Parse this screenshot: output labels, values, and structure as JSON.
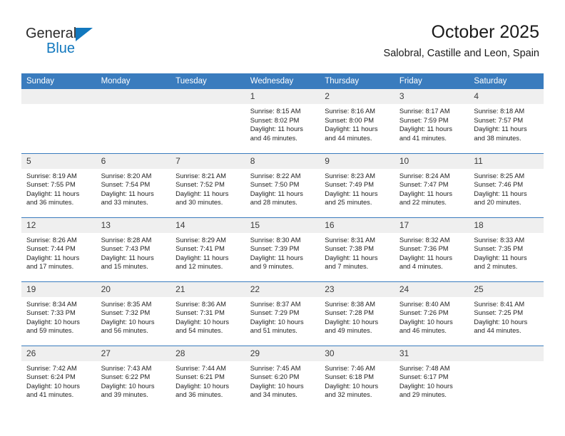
{
  "brand": {
    "name_part1": "General",
    "name_part2": "Blue",
    "triangle_color": "#1278be"
  },
  "header": {
    "title": "October 2025",
    "subtitle": "Salobral, Castille and Leon, Spain"
  },
  "theme": {
    "header_row_bg": "#3a7cbe",
    "header_row_text": "#ffffff",
    "date_band_bg": "#efefef",
    "separator": "#3a7cbe"
  },
  "weekday_headers": [
    "Sunday",
    "Monday",
    "Tuesday",
    "Wednesday",
    "Thursday",
    "Friday",
    "Saturday"
  ],
  "labels": {
    "sunrise_prefix": "Sunrise:",
    "sunset_prefix": "Sunset:",
    "daylight_prefix": "Daylight:"
  },
  "weeks": [
    [
      {
        "day": "",
        "empty": true
      },
      {
        "day": "",
        "empty": true
      },
      {
        "day": "",
        "empty": true
      },
      {
        "day": "1",
        "sunrise": "Sunrise: 8:15 AM",
        "sunset": "Sunset: 8:02 PM",
        "daylight_line1": "Daylight: 11 hours",
        "daylight_line2": "and 46 minutes."
      },
      {
        "day": "2",
        "sunrise": "Sunrise: 8:16 AM",
        "sunset": "Sunset: 8:00 PM",
        "daylight_line1": "Daylight: 11 hours",
        "daylight_line2": "and 44 minutes."
      },
      {
        "day": "3",
        "sunrise": "Sunrise: 8:17 AM",
        "sunset": "Sunset: 7:59 PM",
        "daylight_line1": "Daylight: 11 hours",
        "daylight_line2": "and 41 minutes."
      },
      {
        "day": "4",
        "sunrise": "Sunrise: 8:18 AM",
        "sunset": "Sunset: 7:57 PM",
        "daylight_line1": "Daylight: 11 hours",
        "daylight_line2": "and 38 minutes."
      }
    ],
    [
      {
        "day": "5",
        "sunrise": "Sunrise: 8:19 AM",
        "sunset": "Sunset: 7:55 PM",
        "daylight_line1": "Daylight: 11 hours",
        "daylight_line2": "and 36 minutes."
      },
      {
        "day": "6",
        "sunrise": "Sunrise: 8:20 AM",
        "sunset": "Sunset: 7:54 PM",
        "daylight_line1": "Daylight: 11 hours",
        "daylight_line2": "and 33 minutes."
      },
      {
        "day": "7",
        "sunrise": "Sunrise: 8:21 AM",
        "sunset": "Sunset: 7:52 PM",
        "daylight_line1": "Daylight: 11 hours",
        "daylight_line2": "and 30 minutes."
      },
      {
        "day": "8",
        "sunrise": "Sunrise: 8:22 AM",
        "sunset": "Sunset: 7:50 PM",
        "daylight_line1": "Daylight: 11 hours",
        "daylight_line2": "and 28 minutes."
      },
      {
        "day": "9",
        "sunrise": "Sunrise: 8:23 AM",
        "sunset": "Sunset: 7:49 PM",
        "daylight_line1": "Daylight: 11 hours",
        "daylight_line2": "and 25 minutes."
      },
      {
        "day": "10",
        "sunrise": "Sunrise: 8:24 AM",
        "sunset": "Sunset: 7:47 PM",
        "daylight_line1": "Daylight: 11 hours",
        "daylight_line2": "and 22 minutes."
      },
      {
        "day": "11",
        "sunrise": "Sunrise: 8:25 AM",
        "sunset": "Sunset: 7:46 PM",
        "daylight_line1": "Daylight: 11 hours",
        "daylight_line2": "and 20 minutes."
      }
    ],
    [
      {
        "day": "12",
        "sunrise": "Sunrise: 8:26 AM",
        "sunset": "Sunset: 7:44 PM",
        "daylight_line1": "Daylight: 11 hours",
        "daylight_line2": "and 17 minutes."
      },
      {
        "day": "13",
        "sunrise": "Sunrise: 8:28 AM",
        "sunset": "Sunset: 7:43 PM",
        "daylight_line1": "Daylight: 11 hours",
        "daylight_line2": "and 15 minutes."
      },
      {
        "day": "14",
        "sunrise": "Sunrise: 8:29 AM",
        "sunset": "Sunset: 7:41 PM",
        "daylight_line1": "Daylight: 11 hours",
        "daylight_line2": "and 12 minutes."
      },
      {
        "day": "15",
        "sunrise": "Sunrise: 8:30 AM",
        "sunset": "Sunset: 7:39 PM",
        "daylight_line1": "Daylight: 11 hours",
        "daylight_line2": "and 9 minutes."
      },
      {
        "day": "16",
        "sunrise": "Sunrise: 8:31 AM",
        "sunset": "Sunset: 7:38 PM",
        "daylight_line1": "Daylight: 11 hours",
        "daylight_line2": "and 7 minutes."
      },
      {
        "day": "17",
        "sunrise": "Sunrise: 8:32 AM",
        "sunset": "Sunset: 7:36 PM",
        "daylight_line1": "Daylight: 11 hours",
        "daylight_line2": "and 4 minutes."
      },
      {
        "day": "18",
        "sunrise": "Sunrise: 8:33 AM",
        "sunset": "Sunset: 7:35 PM",
        "daylight_line1": "Daylight: 11 hours",
        "daylight_line2": "and 2 minutes."
      }
    ],
    [
      {
        "day": "19",
        "sunrise": "Sunrise: 8:34 AM",
        "sunset": "Sunset: 7:33 PM",
        "daylight_line1": "Daylight: 10 hours",
        "daylight_line2": "and 59 minutes."
      },
      {
        "day": "20",
        "sunrise": "Sunrise: 8:35 AM",
        "sunset": "Sunset: 7:32 PM",
        "daylight_line1": "Daylight: 10 hours",
        "daylight_line2": "and 56 minutes."
      },
      {
        "day": "21",
        "sunrise": "Sunrise: 8:36 AM",
        "sunset": "Sunset: 7:31 PM",
        "daylight_line1": "Daylight: 10 hours",
        "daylight_line2": "and 54 minutes."
      },
      {
        "day": "22",
        "sunrise": "Sunrise: 8:37 AM",
        "sunset": "Sunset: 7:29 PM",
        "daylight_line1": "Daylight: 10 hours",
        "daylight_line2": "and 51 minutes."
      },
      {
        "day": "23",
        "sunrise": "Sunrise: 8:38 AM",
        "sunset": "Sunset: 7:28 PM",
        "daylight_line1": "Daylight: 10 hours",
        "daylight_line2": "and 49 minutes."
      },
      {
        "day": "24",
        "sunrise": "Sunrise: 8:40 AM",
        "sunset": "Sunset: 7:26 PM",
        "daylight_line1": "Daylight: 10 hours",
        "daylight_line2": "and 46 minutes."
      },
      {
        "day": "25",
        "sunrise": "Sunrise: 8:41 AM",
        "sunset": "Sunset: 7:25 PM",
        "daylight_line1": "Daylight: 10 hours",
        "daylight_line2": "and 44 minutes."
      }
    ],
    [
      {
        "day": "26",
        "sunrise": "Sunrise: 7:42 AM",
        "sunset": "Sunset: 6:24 PM",
        "daylight_line1": "Daylight: 10 hours",
        "daylight_line2": "and 41 minutes."
      },
      {
        "day": "27",
        "sunrise": "Sunrise: 7:43 AM",
        "sunset": "Sunset: 6:22 PM",
        "daylight_line1": "Daylight: 10 hours",
        "daylight_line2": "and 39 minutes."
      },
      {
        "day": "28",
        "sunrise": "Sunrise: 7:44 AM",
        "sunset": "Sunset: 6:21 PM",
        "daylight_line1": "Daylight: 10 hours",
        "daylight_line2": "and 36 minutes."
      },
      {
        "day": "29",
        "sunrise": "Sunrise: 7:45 AM",
        "sunset": "Sunset: 6:20 PM",
        "daylight_line1": "Daylight: 10 hours",
        "daylight_line2": "and 34 minutes."
      },
      {
        "day": "30",
        "sunrise": "Sunrise: 7:46 AM",
        "sunset": "Sunset: 6:18 PM",
        "daylight_line1": "Daylight: 10 hours",
        "daylight_line2": "and 32 minutes."
      },
      {
        "day": "31",
        "sunrise": "Sunrise: 7:48 AM",
        "sunset": "Sunset: 6:17 PM",
        "daylight_line1": "Daylight: 10 hours",
        "daylight_line2": "and 29 minutes."
      },
      {
        "day": "",
        "empty": true
      }
    ]
  ]
}
